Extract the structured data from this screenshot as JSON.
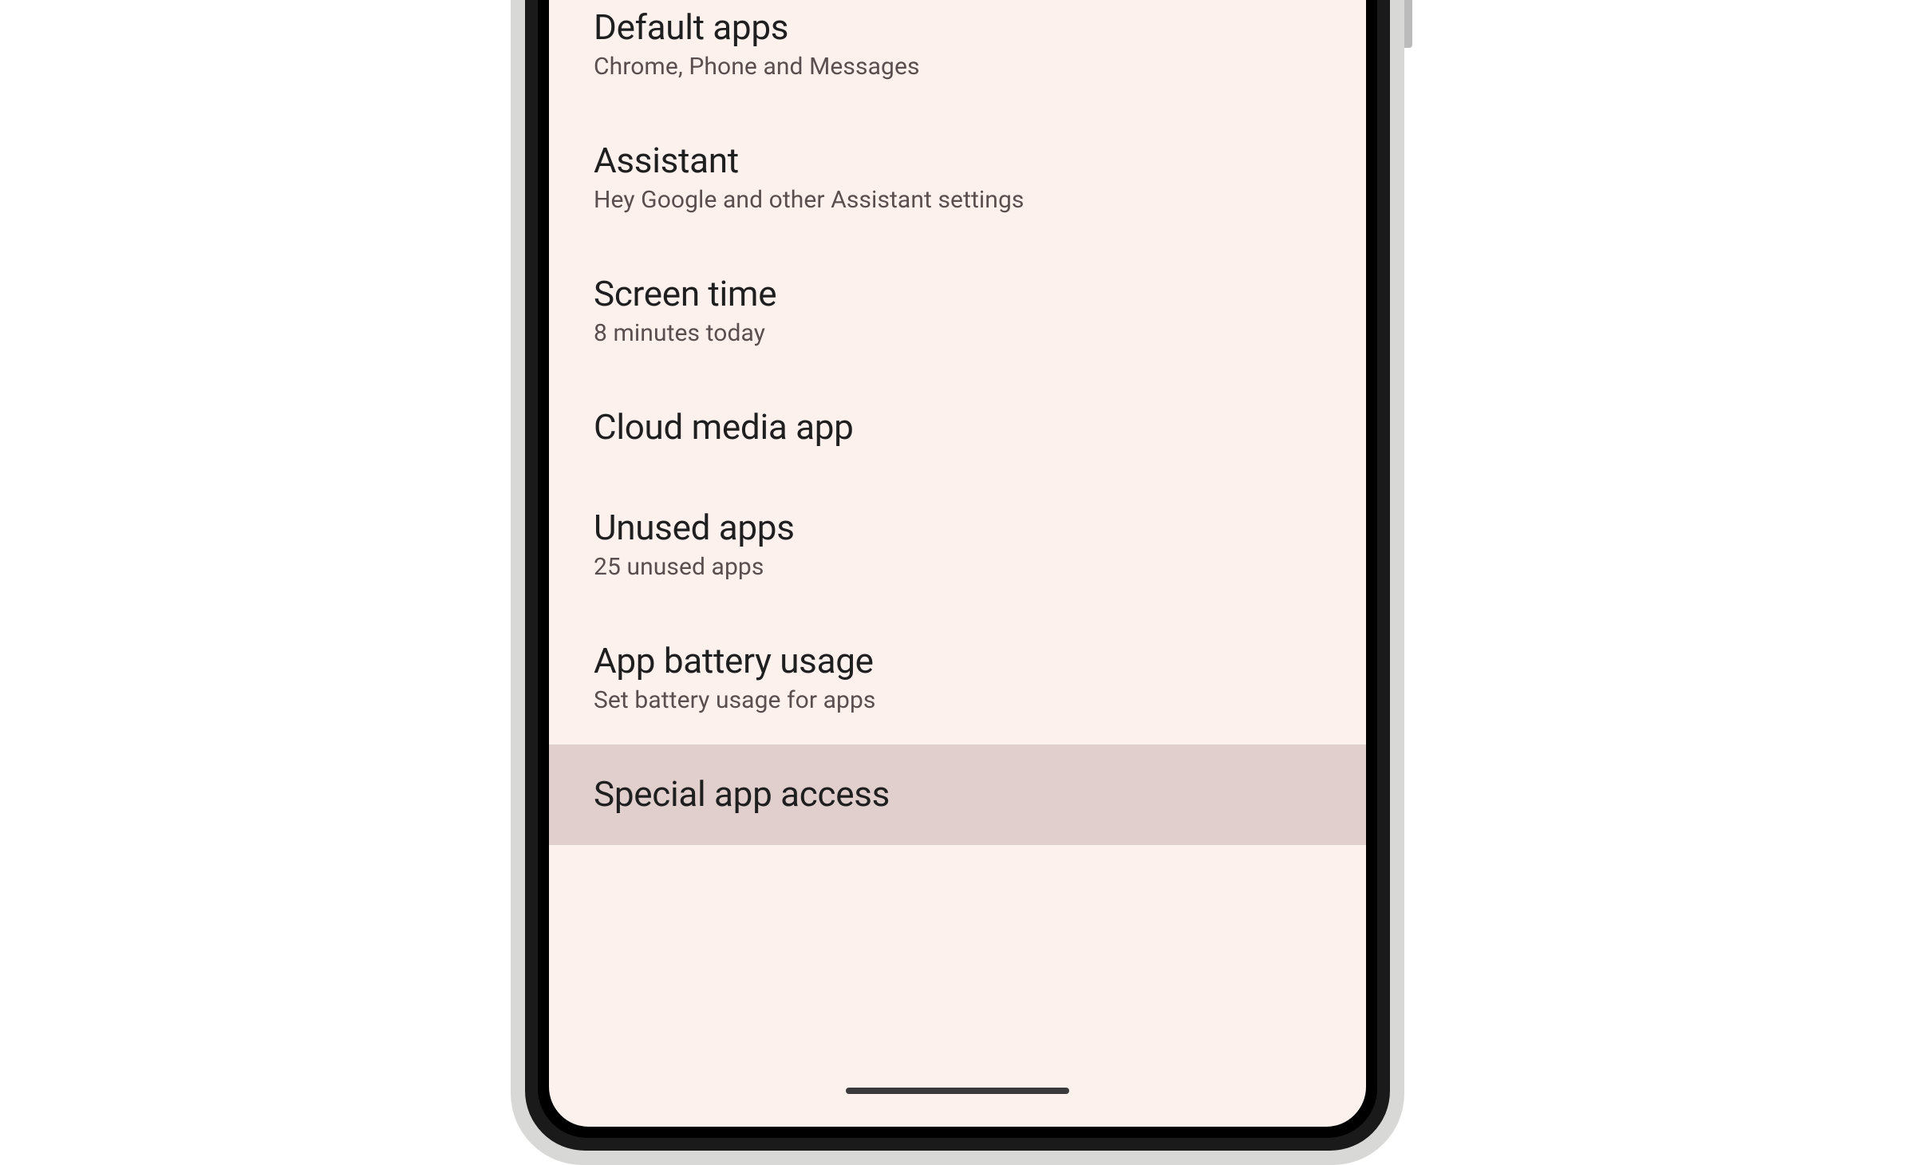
{
  "settings": {
    "items": [
      {
        "title": "Default apps",
        "subtitle": "Chrome, Phone and Messages"
      },
      {
        "title": "Assistant",
        "subtitle": "Hey Google and other Assistant settings"
      },
      {
        "title": "Screen time",
        "subtitle": "8 minutes today"
      },
      {
        "title": "Cloud media app",
        "subtitle": ""
      },
      {
        "title": "Unused apps",
        "subtitle": "25 unused apps"
      },
      {
        "title": "App battery usage",
        "subtitle": "Set battery usage for apps"
      },
      {
        "title": "Special app access",
        "subtitle": ""
      }
    ]
  }
}
